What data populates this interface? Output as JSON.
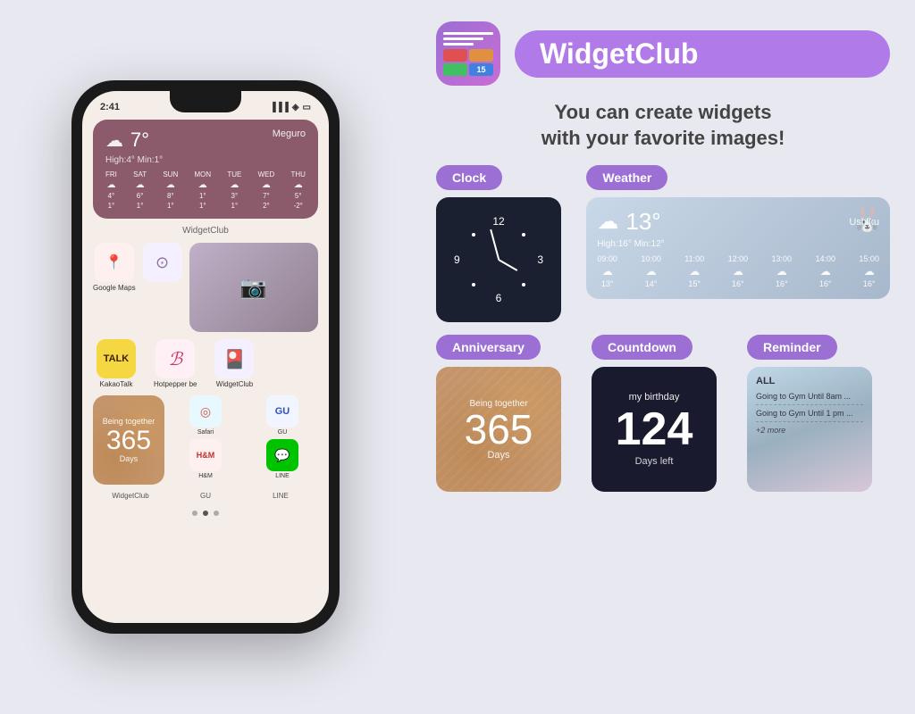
{
  "page": {
    "bg_color": "#e8e8f0"
  },
  "phone": {
    "time": "2:41",
    "weather": {
      "temp": "7°",
      "location": "Meguro",
      "high_low": "High:4° Min:1°",
      "days": [
        "FRI",
        "SAT",
        "SUN",
        "MON",
        "TUE",
        "WED",
        "THU"
      ],
      "temps": [
        "4°",
        "6°",
        "8°",
        "1°",
        "3°",
        "7°",
        "5°"
      ],
      "mins": [
        "1°",
        "1°",
        "1°",
        "1°",
        "1°",
        "2°",
        "-2°"
      ]
    },
    "label": "WidgetClub",
    "apps": [
      {
        "name": "Google Maps",
        "icon": "📍",
        "bg": "#fff0f0"
      },
      {
        "name": "",
        "icon": "🎯",
        "bg": "#f5f0ff"
      },
      {
        "name": "WidgetClub",
        "icon": "📸",
        "bg": "#f0f0f0"
      }
    ],
    "apps2": [
      {
        "name": "KakaoTalk",
        "icon": "💬",
        "bg": "#f5d742"
      },
      {
        "name": "Hotpepper be",
        "icon": "ℬ",
        "bg": "#fff0f5"
      },
      {
        "name": "WidgetClub",
        "icon": "📷",
        "bg": "#f5f0ff"
      }
    ],
    "anniversary": {
      "being_together": "Being together",
      "number": "365",
      "days": "Days",
      "widget_label": "WidgetClub"
    },
    "small_apps": [
      {
        "name": "Safari",
        "icon": "🧭",
        "bg": "#e8f0ff"
      },
      {
        "name": "H&M",
        "icon": "H&M",
        "bg": "#fff0f0"
      }
    ],
    "small_apps2": [
      {
        "name": "GU",
        "icon": "GU",
        "bg": "#f0f5ff"
      },
      {
        "name": "LINE",
        "icon": "💚",
        "bg": "#00c300"
      }
    ]
  },
  "app": {
    "name": "WidgetClub",
    "tagline_line1": "You can create widgets",
    "tagline_line2": "with your favorite images!"
  },
  "widgets": {
    "clock_label": "Clock",
    "weather_label": "Weather",
    "anniversary_label": "Anniversary",
    "countdown_label": "Countdown",
    "reminder_label": "Reminder",
    "weather_preview": {
      "temp": "13°",
      "location": "Ushiku",
      "detail": "High:16° Min:12°",
      "hours": [
        "09:00",
        "10:00",
        "11:00",
        "12:00",
        "13:00",
        "14:00",
        "15:00"
      ],
      "hour_temps": [
        "13°",
        "14°",
        "15°",
        "16°",
        "16°",
        "16°",
        "16°"
      ]
    },
    "anniversary_preview": {
      "being_together": "Being together",
      "number": "365",
      "days": "Days"
    },
    "countdown_preview": {
      "title": "my birthday",
      "number": "124",
      "sub": "Days left"
    },
    "reminder_preview": {
      "header": "ALL",
      "items": [
        "Going to Gym Until 8am ...",
        "Going to Gym Until 1 pm ..."
      ],
      "more": "+2 more"
    }
  }
}
